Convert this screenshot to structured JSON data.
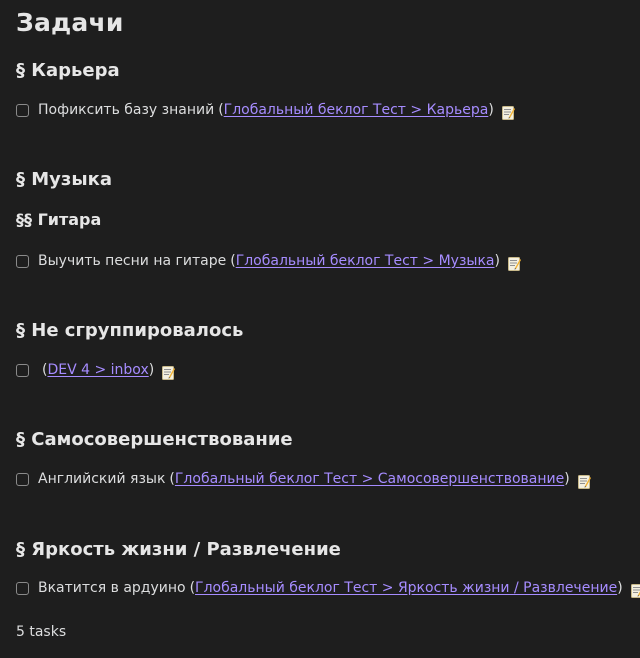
{
  "title": "Задачи",
  "sections": [
    {
      "heading": "§ Карьера",
      "tasks": [
        {
          "text": "Пофиксить базу знаний",
          "open_paren": "(",
          "link": "Глобальный беклог Тест > Карьера",
          "close_paren": ")",
          "icon": "memo-icon"
        }
      ]
    },
    {
      "heading": "§ Музыка",
      "subheading": "§§ Гитара",
      "tasks": [
        {
          "text": "Выучить песни на гитаре",
          "open_paren": "(",
          "link": "Глобальный беклог Тест > Музыка",
          "close_paren": ")",
          "icon": "memo-icon"
        }
      ]
    },
    {
      "heading": "§ Не сгруппировалось",
      "tasks": [
        {
          "text": "",
          "open_paren": "(",
          "link": "DEV 4 > inbox",
          "close_paren": ")",
          "icon": "memo-icon"
        }
      ]
    },
    {
      "heading": "§ Самосовершенствование",
      "tasks": [
        {
          "text": "Английский язык",
          "open_paren": "(",
          "link": "Глобальный беклог Тест > Самосовершенствование",
          "close_paren": ")",
          "icon": "memo-icon"
        }
      ]
    },
    {
      "heading": "§ Яркость жизни / Развлечение",
      "tasks": [
        {
          "text": "Вкатится в ардуино",
          "open_paren": "(",
          "link": "Глобальный беклог Тест > Яркость жизни / Развлечение",
          "close_paren": ")",
          "icon": "memo-icon"
        }
      ]
    }
  ],
  "footer": "5 tasks",
  "colors": {
    "background": "#1e1e1e",
    "text": "#dcddde",
    "link": "#a68cff"
  }
}
